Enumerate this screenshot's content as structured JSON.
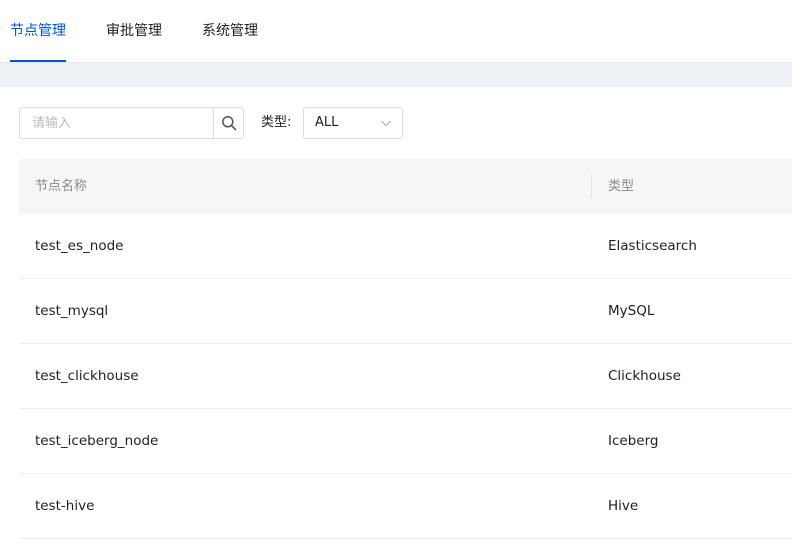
{
  "tabs": [
    {
      "label": "节点管理",
      "active": true
    },
    {
      "label": "审批管理",
      "active": false
    },
    {
      "label": "系统管理",
      "active": false
    }
  ],
  "filter": {
    "search_placeholder": "请输入",
    "search_value": "",
    "type_label": "类型:",
    "type_selected": "ALL"
  },
  "table": {
    "columns": [
      "节点名称",
      "类型"
    ],
    "rows": [
      {
        "name": "test_es_node",
        "type": "Elasticsearch"
      },
      {
        "name": "test_mysql",
        "type": "MySQL"
      },
      {
        "name": "test_clickhouse",
        "type": "Clickhouse"
      },
      {
        "name": "test_iceberg_node",
        "type": "Iceberg"
      },
      {
        "name": "test-hive",
        "type": "Hive"
      }
    ]
  },
  "colors": {
    "accent": "#0052d9",
    "band": "#eef1f6",
    "header_bg": "#f5f6f8"
  },
  "icons": {
    "search": "search-icon",
    "dropdown": "chevron-down-icon"
  }
}
